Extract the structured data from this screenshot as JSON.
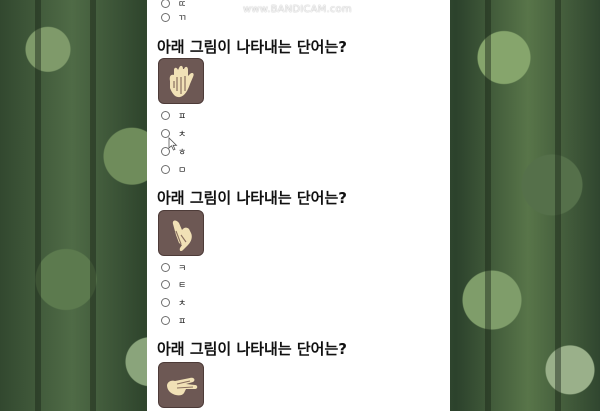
{
  "watermark": "www.BANDICAM.com",
  "questions": [
    {
      "title": "아래 그림이 나타내는 단어는?",
      "options": [
        "ㅍ",
        "ㅊ",
        "ㅎ",
        "ㅁ"
      ]
    },
    {
      "title": "아래 그림이 나타내는 단어는?",
      "options": [
        "ㅋ",
        "ㅌ",
        "ㅊ",
        "ㅍ"
      ]
    },
    {
      "title": "아래 그림이 나타내는 단어는?",
      "options": []
    }
  ],
  "previous_options": [
    "ㄸ",
    "ㄲ"
  ],
  "colors": {
    "panel": "#ffffff",
    "card": "#6d5854",
    "hand": "#f1e1b6",
    "text": "#111111"
  }
}
